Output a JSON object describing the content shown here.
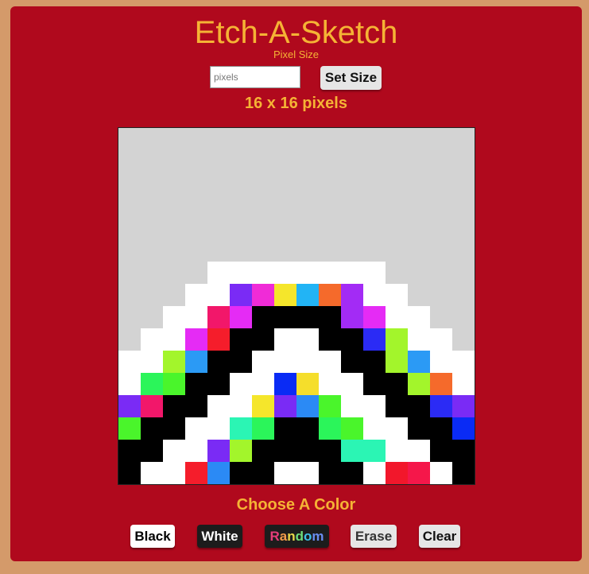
{
  "app": {
    "title": "Etch-A-Sketch"
  },
  "controls": {
    "size_label": "Pixel Size",
    "size_placeholder": "pixels",
    "set_size_label": "Set Size",
    "dimensions_text": "16 x 16 pixels"
  },
  "palette": {
    "heading": "Choose A Color",
    "buttons": {
      "black": "Black",
      "white": "White",
      "random": "Random",
      "erase": "Erase",
      "clear": "Clear"
    },
    "random_letter_colors": [
      "#e63d7a",
      "#f39c4b",
      "#e8d84a",
      "#6fdc7a",
      "#3fbfe8",
      "#6a8df0"
    ]
  },
  "canvas": {
    "grid_size": 16,
    "colors": {
      "G": "#d3d3d3",
      "W": "#ffffff",
      "K": "#000000",
      "P": "#7a2bf5",
      "M": "#f02bd7",
      "Y": "#f5e62b",
      "C": "#22b4f5",
      "O": "#f56a2b",
      "V": "#a32bf5",
      "R": "#f2176a",
      "F": "#e52bf5",
      "E": "#f51d2b",
      "B": "#2b2bf5",
      "L": "#a3f52b",
      "S": "#2b9af5",
      "N": "#2bf55a",
      "H": "#4af52b",
      "D": "#0a2bf5",
      "U": "#f5de2b",
      "Q": "#7a2bf5",
      "A": "#2b8af5",
      "T": "#2bf5b4",
      "J": "#f2172b",
      "I": "#f5174a"
    },
    "rows": [
      "GGGGGGGGGGGGGGGG",
      "GGGGGGGGGGGGGGGG",
      "GGGGGGGGGGGGGGGG",
      "GGGGGGGGGGGGGGGG",
      "GGGGGGGGGGGGGGGG",
      "GGGGGGGGGGGGGGGG",
      "GGGGWWWWWWWWGGGG",
      "GGGWWPMYCOVWWGGG",
      "GGWWRFKKKKVFWWGG",
      "GWWFEKKWWKKBLWWG",
      "WWLSKKWWWWKKLSWW",
      "WNHKKWWDUWWKKLOW",
      "PRKKWWYQAHWWKKBP",
      "HKKWWTNKKNHWWKKD",
      "KKWWPLKKKKTTWWKK",
      "KWWEAKKWWKKWJIWK"
    ]
  }
}
